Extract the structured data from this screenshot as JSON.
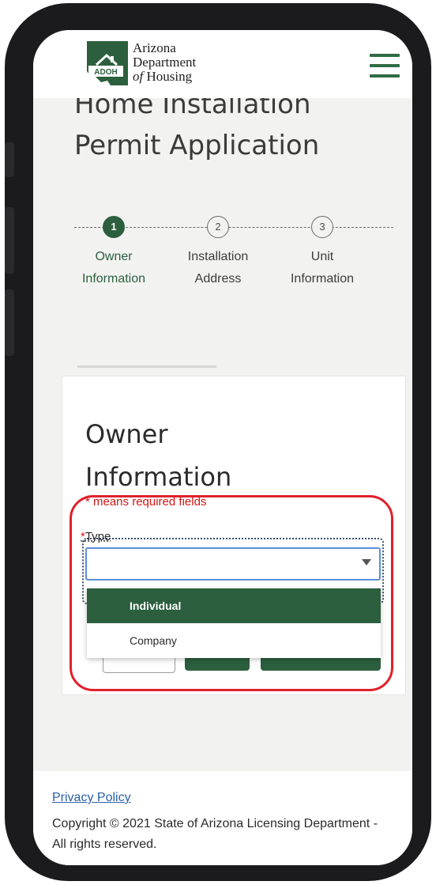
{
  "header": {
    "logo_badge": "ADOH",
    "logo_line1": "Arizona",
    "logo_line2": "Department",
    "logo_line3_prefix": "of",
    "logo_line3_suffix": " Housing"
  },
  "page": {
    "title_line1_partial": "Home Installation",
    "title_line2": "Permit Application"
  },
  "steps": [
    {
      "number": "1",
      "line1": "Owner",
      "line2": "Information",
      "active": true
    },
    {
      "number": "2",
      "line1": "Installation",
      "line2": "Address",
      "active": false
    },
    {
      "number": "3",
      "line1": "Unit",
      "line2": "Information",
      "active": false
    }
  ],
  "card": {
    "title_line1": "Owner",
    "title_line2": "Information",
    "required_note": "* means required fields"
  },
  "form": {
    "type_required_mark": "*",
    "type_label": "Type",
    "type_value": "",
    "options": [
      "Individual",
      "Company"
    ],
    "highlighted_option": "Individual"
  },
  "footer": {
    "privacy_link": "Privacy Policy",
    "copyright": "Copyright © 2021 State of Arizona Licensing Department - All rights reserved."
  },
  "colors": {
    "brand_green": "#2c5f3d",
    "required_red": "#d21414",
    "annotation_red": "#e0202a",
    "link_blue": "#2b5fa8"
  }
}
